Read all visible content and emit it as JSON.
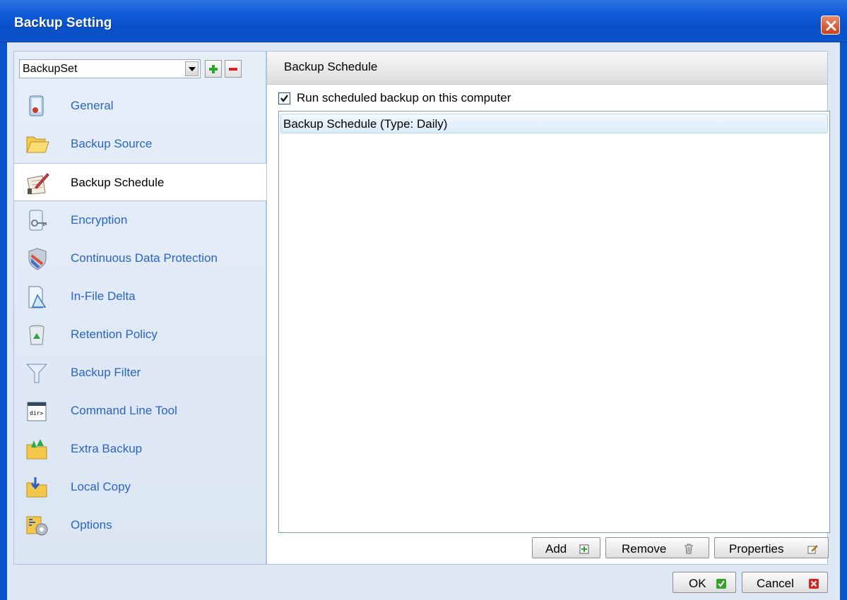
{
  "window": {
    "title": "Backup Setting"
  },
  "backupset": {
    "selected": "BackupSet"
  },
  "nav": {
    "items": [
      {
        "label": "General",
        "icon": "general-icon"
      },
      {
        "label": "Backup Source",
        "icon": "folder-icon"
      },
      {
        "label": "Backup Schedule",
        "icon": "schedule-icon",
        "selected": true
      },
      {
        "label": "Encryption",
        "icon": "encryption-key-icon"
      },
      {
        "label": "Continuous Data Protection",
        "icon": "shield-icon"
      },
      {
        "label": "In-File Delta",
        "icon": "delta-icon"
      },
      {
        "label": "Retention Policy",
        "icon": "recycle-bin-icon"
      },
      {
        "label": "Backup Filter",
        "icon": "filter-funnel-icon"
      },
      {
        "label": "Command Line Tool",
        "icon": "command-line-icon"
      },
      {
        "label": "Extra Backup",
        "icon": "extra-backup-folder-icon"
      },
      {
        "label": "Local Copy",
        "icon": "local-copy-folder-icon"
      },
      {
        "label": "Options",
        "icon": "options-gear-icon"
      }
    ]
  },
  "panel": {
    "title": "Backup Schedule",
    "run_scheduled_label": "Run scheduled backup on this computer",
    "run_scheduled_checked": true,
    "schedules": [
      "Backup Schedule (Type: Daily)"
    ],
    "add_label": "Add",
    "remove_label": "Remove",
    "properties_label": "Properties"
  },
  "footer": {
    "ok_label": "OK",
    "cancel_label": "Cancel"
  },
  "colors": {
    "title_bar": "#0a55c9",
    "nav_link": "#2a64c4",
    "ok_check": "#3aa02a",
    "cancel_x": "#d02828"
  }
}
